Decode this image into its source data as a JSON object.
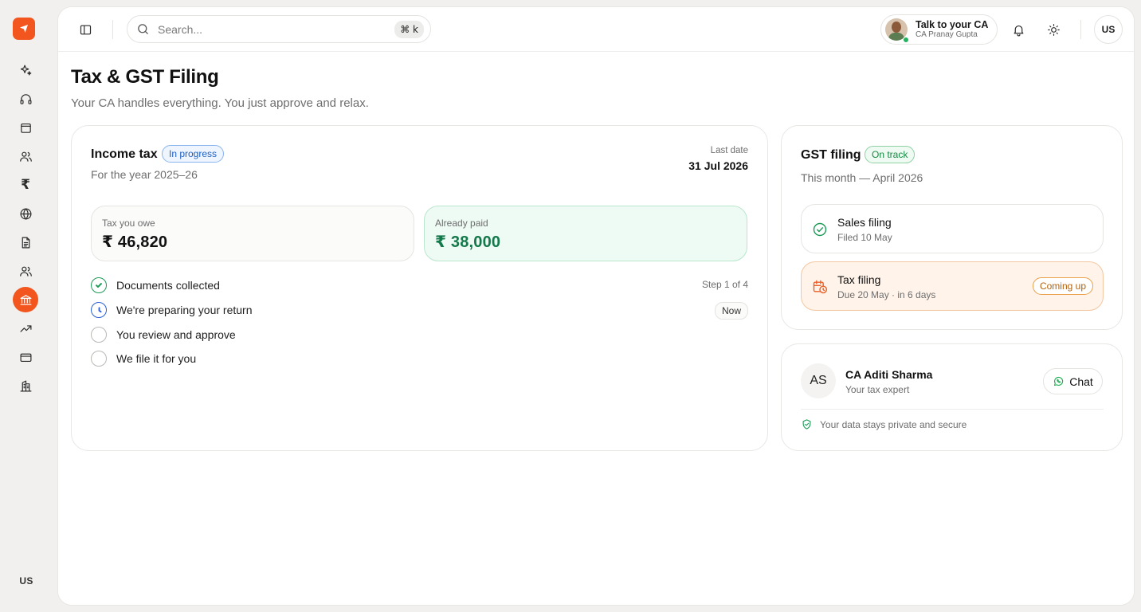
{
  "rail": {
    "items": [
      {
        "name": "sparkles-icon"
      },
      {
        "name": "headphones-icon"
      },
      {
        "name": "wallet-icon"
      },
      {
        "name": "users-icon"
      },
      {
        "name": "rupee-icon",
        "glyph": "₹"
      },
      {
        "name": "globe-icon"
      },
      {
        "name": "document-icon"
      },
      {
        "name": "team-icon"
      },
      {
        "name": "bank-icon",
        "active": true
      },
      {
        "name": "trending-up-icon"
      },
      {
        "name": "credit-card-icon"
      },
      {
        "name": "building-icon"
      }
    ],
    "user_label": "US"
  },
  "topbar": {
    "search_placeholder": "Search...",
    "shortcut": "⌘ k",
    "ca_title": "Talk to your CA",
    "ca_name": "CA Pranay Gupta",
    "user_initials": "US"
  },
  "page": {
    "title": "Tax & GST Filing",
    "subtitle": "Your CA handles everything. You just approve and relax."
  },
  "income": {
    "title": "Income tax",
    "status": "In progress",
    "period": "For the year 2025–26",
    "last_date_label": "Last date",
    "last_date": "31 Jul 2026",
    "owe_label": "Tax you owe",
    "owe_value": "₹ 46,820",
    "paid_label": "Already paid",
    "paid_value": "₹ 38,000",
    "step_count": "Step 1 of 4",
    "now_label": "Now",
    "steps": [
      {
        "label": "Documents collected",
        "state": "done"
      },
      {
        "label": "We're preparing your return",
        "state": "current"
      },
      {
        "label": "You review and approve",
        "state": "pending"
      },
      {
        "label": "We file it for you",
        "state": "pending"
      }
    ]
  },
  "gst": {
    "title": "GST filing",
    "status": "On track",
    "period": "This month — April 2026",
    "sales": {
      "title": "Sales filing",
      "sub": "Filed 10 May"
    },
    "tax": {
      "title": "Tax filing",
      "sub": "Due 20 May · in 6 days",
      "badge": "Coming up"
    }
  },
  "expert": {
    "initials": "AS",
    "name": "CA Aditi Sharma",
    "role": "Your tax expert",
    "chat_label": "Chat",
    "secure_note": "Your data stays private and secure"
  },
  "colors": {
    "brand": "#f2551d",
    "green": "#1d9a58",
    "blue": "#2a5fd6",
    "orange": "#e8a04a"
  }
}
